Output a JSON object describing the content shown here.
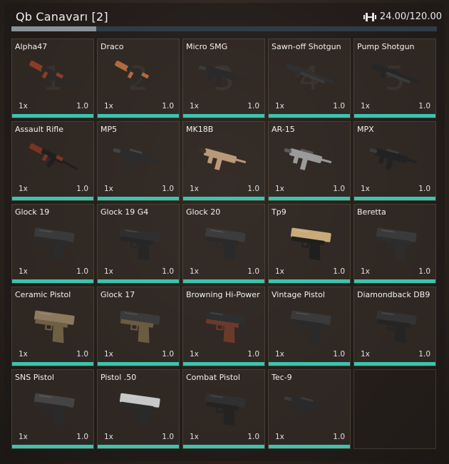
{
  "header": {
    "title": "Qb Canavarı [2]",
    "weight_text": "24.00/120.00",
    "weight_fraction": 0.2,
    "icon": "dumbbell-icon"
  },
  "inventory": {
    "accent_color": "#3cc4ae",
    "slots": [
      {
        "name": "Alpha47",
        "count": "1x",
        "weight": "1.0",
        "slot_number": "1",
        "icon": "ak-rifle-icon",
        "durability": 1.0
      },
      {
        "name": "Draco",
        "count": "1x",
        "weight": "1.0",
        "slot_number": "2",
        "icon": "draco-pistol-icon",
        "durability": 1.0
      },
      {
        "name": "Micro SMG",
        "count": "1x",
        "weight": "1.0",
        "slot_number": "3",
        "icon": "micro-smg-icon",
        "durability": 1.0
      },
      {
        "name": "Sawn-off Shotgun",
        "count": "1x",
        "weight": "1.0",
        "slot_number": "4",
        "icon": "sawnoff-shotgun-icon",
        "durability": 1.0
      },
      {
        "name": "Pump Shotgun",
        "count": "1x",
        "weight": "1.0",
        "slot_number": "5",
        "icon": "pump-shotgun-icon",
        "durability": 1.0
      },
      {
        "name": "Assault Rifle",
        "count": "1x",
        "weight": "1.0",
        "icon": "assault-rifle-icon",
        "durability": 1.0
      },
      {
        "name": "MP5",
        "count": "1x",
        "weight": "1.0",
        "icon": "mp5-icon",
        "durability": 1.0
      },
      {
        "name": "MK18B",
        "count": "1x",
        "weight": "1.0",
        "icon": "mk18b-icon",
        "durability": 1.0
      },
      {
        "name": "AR-15",
        "count": "1x",
        "weight": "1.0",
        "icon": "ar15-icon",
        "durability": 1.0
      },
      {
        "name": "MPX",
        "count": "1x",
        "weight": "1.0",
        "icon": "mpx-icon",
        "durability": 1.0
      },
      {
        "name": "Glock 19",
        "count": "1x",
        "weight": "1.0",
        "icon": "glock-19-icon",
        "durability": 1.0
      },
      {
        "name": "Glock 19 G4",
        "count": "1x",
        "weight": "1.0",
        "icon": "glock-19-g4-icon",
        "durability": 1.0
      },
      {
        "name": "Glock 20",
        "count": "1x",
        "weight": "1.0",
        "icon": "glock-20-icon",
        "durability": 1.0
      },
      {
        "name": "Tp9",
        "count": "1x",
        "weight": "1.0",
        "icon": "tp9-icon",
        "durability": 1.0
      },
      {
        "name": "Beretta",
        "count": "1x",
        "weight": "1.0",
        "icon": "beretta-icon",
        "durability": 1.0
      },
      {
        "name": "Ceramic Pistol",
        "count": "1x",
        "weight": "1.0",
        "icon": "ceramic-pistol-icon",
        "durability": 1.0
      },
      {
        "name": "Glock 17",
        "count": "1x",
        "weight": "1.0",
        "icon": "glock-17-icon",
        "durability": 1.0
      },
      {
        "name": "Browning Hi-Power",
        "count": "1x",
        "weight": "1.0",
        "icon": "browning-hi-power-icon",
        "durability": 1.0
      },
      {
        "name": "Vintage Pistol",
        "count": "1x",
        "weight": "1.0",
        "icon": "vintage-pistol-icon",
        "durability": 1.0
      },
      {
        "name": "Diamondback DB9",
        "count": "1x",
        "weight": "1.0",
        "icon": "diamondback-db9-icon",
        "durability": 1.0
      },
      {
        "name": "SNS Pistol",
        "count": "1x",
        "weight": "1.0",
        "icon": "sns-pistol-icon",
        "durability": 1.0
      },
      {
        "name": "Pistol .50",
        "count": "1x",
        "weight": "1.0",
        "icon": "pistol-50-icon",
        "durability": 1.0
      },
      {
        "name": "Combat Pistol",
        "count": "1x",
        "weight": "1.0",
        "icon": "combat-pistol-icon",
        "durability": 1.0
      },
      {
        "name": "Tec-9",
        "count": "1x",
        "weight": "1.0",
        "icon": "tec9-icon",
        "durability": 1.0
      },
      {
        "empty": true
      }
    ]
  }
}
